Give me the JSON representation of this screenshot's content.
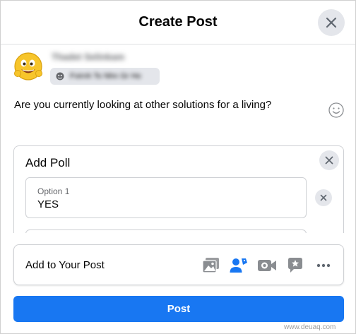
{
  "header": {
    "title": "Create Post",
    "close_icon": "close-icon"
  },
  "user": {
    "name": "Thadet Selinkam",
    "audience_label": "Fxirnh To Nhn Gr Ho",
    "avatar_icon": "emoji-avatar",
    "audience_icon": "audience-icon"
  },
  "post": {
    "text": "Are you currently looking at other solutions for a living?",
    "emoji_icon": "smiley-icon"
  },
  "poll": {
    "title": "Add Poll",
    "options": [
      {
        "label": "Option 1",
        "value": "YES"
      }
    ]
  },
  "add_to_post": {
    "label": "Add to Your Post",
    "tools": [
      {
        "name": "photo-video",
        "icon": "photo-icon",
        "color": "#45bd62"
      },
      {
        "name": "tag-people",
        "icon": "tag-people-icon",
        "color": "#1877f2"
      },
      {
        "name": "live-video",
        "icon": "video-camera-icon",
        "color": "#65676b"
      },
      {
        "name": "feature",
        "icon": "star-chat-icon",
        "color": "#65676b"
      },
      {
        "name": "more",
        "icon": "more-icon",
        "color": "#65676b"
      }
    ]
  },
  "actions": {
    "post_label": "Post"
  },
  "colors": {
    "primary": "#1877f2",
    "gray_bg": "#e4e6eb",
    "border": "#ced0d4",
    "secondary_text": "#65676b"
  },
  "watermark": "www.deuaq.com"
}
